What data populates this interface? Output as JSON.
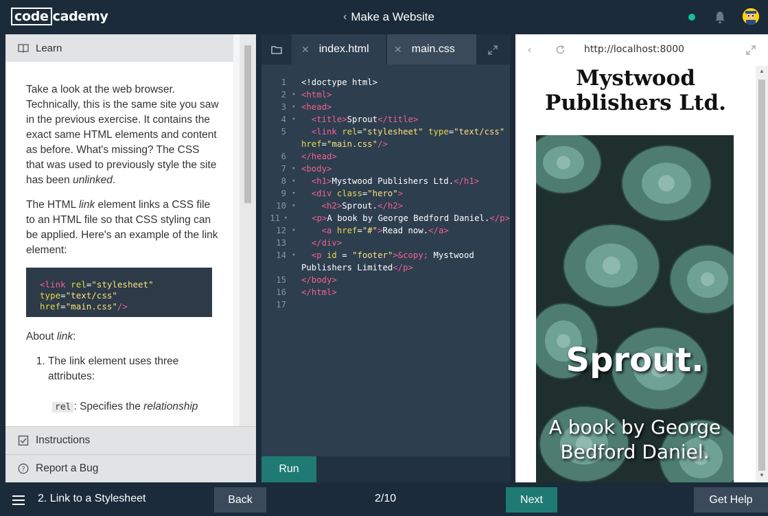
{
  "header": {
    "logo_box": "code",
    "logo_rest": "cademy",
    "course_title": "Make a Website",
    "status_color": "#13c29a"
  },
  "learn": {
    "tab_label": "Learn",
    "para1_a": "Take a look at the web browser. Technically, this is the same site you saw in the previous exercise. It contains the exact same HTML elements and content as before. What's missing? The CSS that was used to previously style the site has been ",
    "para1_em": "unlinked",
    "para1_end": ".",
    "para2_a": "The HTML ",
    "para2_em": "link",
    "para2_b": " element links a CSS file to an HTML file so that CSS styling can be applied. Here's an example of the link element:",
    "snippet": {
      "open": "<link",
      "rel_attr": "rel",
      "rel_val": "\"stylesheet\"",
      "type_attr": "type",
      "type_val": "\"text/css\"",
      "href_attr": "href",
      "href_val": "\"main.css\"",
      "close": "/>"
    },
    "about_a": "About ",
    "about_em": "link",
    "about_b": ":",
    "list_item1": "The link element uses three attributes:",
    "sub_code": "rel",
    "sub_text_a": ": Specifies the ",
    "sub_text_em": "relationship"
  },
  "panels": {
    "instructions": "Instructions",
    "report_bug": "Report a Bug"
  },
  "editor": {
    "tabs": [
      {
        "label": "index.html",
        "active": true
      },
      {
        "label": "main.css",
        "active": false
      }
    ],
    "run_label": "Run",
    "lines": [
      {
        "n": "1",
        "fold": ""
      },
      {
        "n": "2",
        "fold": "▾"
      },
      {
        "n": "3",
        "fold": "▾"
      },
      {
        "n": "4",
        "fold": "▾"
      },
      {
        "n": "5",
        "fold": ""
      },
      {
        "n": "",
        "fold": ""
      },
      {
        "n": "6",
        "fold": ""
      },
      {
        "n": "7",
        "fold": "▾"
      },
      {
        "n": "8",
        "fold": "▾"
      },
      {
        "n": "9",
        "fold": "▾"
      },
      {
        "n": "10",
        "fold": "▾"
      },
      {
        "n": "11",
        "fold": "▾"
      },
      {
        "n": "12",
        "fold": "▾"
      },
      {
        "n": "13",
        "fold": ""
      },
      {
        "n": "14",
        "fold": "▾"
      },
      {
        "n": "",
        "fold": ""
      },
      {
        "n": "15",
        "fold": ""
      },
      {
        "n": "16",
        "fold": ""
      },
      {
        "n": "17",
        "fold": ""
      }
    ],
    "code": {
      "doctype": "<!doctype html>",
      "html_open": "<html>",
      "head_open": "<head>",
      "title_open": "<title>",
      "title_text": "Sprout",
      "title_close": "</title>",
      "link_open": "<link",
      "rel": "rel",
      "rel_val": "\"stylesheet\"",
      "type": "type",
      "type_val": "\"text/css\"",
      "href": "href",
      "href_val": "\"main.css\"",
      "link_close": "/>",
      "head_close": "</head>",
      "body_open": "<body>",
      "h1_open": "<h1>",
      "h1_text": "Mystwood Publishers Ltd.",
      "h1_close": "</h1>",
      "div_open": "<div",
      "class": "class",
      "class_val": "\"hero\"",
      "gt": ">",
      "h2_open": "<h2>",
      "h2_text": "Sprout.",
      "h2_close": "</h2>",
      "p_open": "<p>",
      "p_text": "A book by George Bedford Daniel.",
      "p_close": "</p>",
      "a_open": "<a",
      "a_href": "href",
      "a_href_val": "\"#\"",
      "a_text": "Read now.",
      "a_close": "</a>",
      "div_close": "</div>",
      "p2_open": "<p",
      "id": "id",
      "eq": " = ",
      "id_val": "\"footer\"",
      "copy": ">&copy;",
      "footer_text_a": " Mystwood",
      "footer_text_b": "Publishers Limited",
      "p2_close": "</p>",
      "body_close": "</body>",
      "html_close": "</html>"
    }
  },
  "browser": {
    "url": "http://localhost:8000",
    "site_title_1": "Mystwood",
    "site_title_2": "Publishers Ltd.",
    "hero_h2": "Sprout.",
    "hero_p": "A book by George Bedford Daniel."
  },
  "footer": {
    "lesson": "2. Link to a Stylesheet",
    "back": "Back",
    "progress": "2/10",
    "next": "Next",
    "help": "Get Help"
  },
  "colors": {
    "accent": "#1f7a73",
    "bg_dark": "#1b2b3a",
    "editor_bg": "#2d3e4f"
  }
}
